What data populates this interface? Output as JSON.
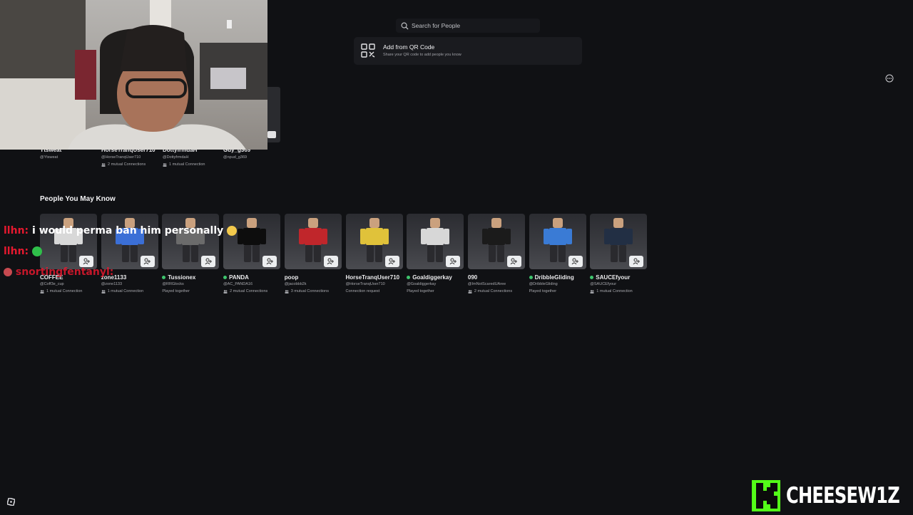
{
  "search": {
    "placeholder": "Search for People"
  },
  "qr": {
    "title": "Add from QR Code",
    "subtitle": "Share your QR code to add people you know"
  },
  "connections": [
    {
      "name": "Ytsweat",
      "handle": "@Ytsweat",
      "info": ""
    },
    {
      "name": "HorseTranqUser710",
      "handle": "@HorseTranqUser710",
      "info": "2 mutual Connections"
    },
    {
      "name": "DottyfrmdaH",
      "handle": "@DottyfrmdaH",
      "info": "1 mutual Connection"
    },
    {
      "name": "Guy_g369",
      "handle": "@npud_g369",
      "info": ""
    }
  ],
  "people_section": {
    "title": "People You May Know"
  },
  "people": [
    {
      "name": "COFFEE",
      "handle": "@Coff3e_cup",
      "info": "1 mutual Connection",
      "online": false,
      "outfit": "#d8d8d8"
    },
    {
      "name": "zone1133",
      "handle": "@zone1133",
      "info": "1 mutual Connection",
      "online": false,
      "outfit": "#3b6fd6"
    },
    {
      "name": "Tussionex",
      "handle": "@RRGlocks",
      "info": "Played together",
      "online": true,
      "outfit": "#6b6b6b"
    },
    {
      "name": "PANDA",
      "handle": "@AC_PANDA16",
      "info": "2 mutual Connections",
      "online": true,
      "outfit": "#0d0d0d"
    },
    {
      "name": "poop",
      "handle": "@jacobbb2k",
      "info": "3 mutual Connections",
      "online": false,
      "outfit": "#c0262b"
    },
    {
      "name": "HorseTranqUser710",
      "handle": "@HorseTranqUser710",
      "info": "Connection request",
      "online": false,
      "outfit": "#e0c23a"
    },
    {
      "name": "Goaldiggerkay",
      "handle": "@Goaldiggerkay",
      "info": "Played together",
      "online": true,
      "outfit": "#d7d7d7"
    },
    {
      "name": "090",
      "handle": "@ImNotScaredUAree",
      "info": "2 mutual Connections",
      "online": false,
      "outfit": "#1b1b1b"
    },
    {
      "name": "DribbleGliding",
      "handle": "@DribbleGliding",
      "info": "Played together",
      "online": true,
      "outfit": "#3a7bd5"
    },
    {
      "name": "SAUCEfyour",
      "handle": "@SAUCEfyour",
      "info": "1 mutual Connection",
      "online": true,
      "outfit": "#222f44"
    }
  ],
  "chat": [
    {
      "user": "llhn:",
      "message": "i would perma ban him personally"
    },
    {
      "user": "llhn:",
      "message": ""
    },
    {
      "user": "snortingfentanyl:",
      "message": ""
    }
  ],
  "brand": {
    "text": "CHEESEW1Z",
    "logo_letter": "K",
    "logo_color": "#53fc18"
  }
}
